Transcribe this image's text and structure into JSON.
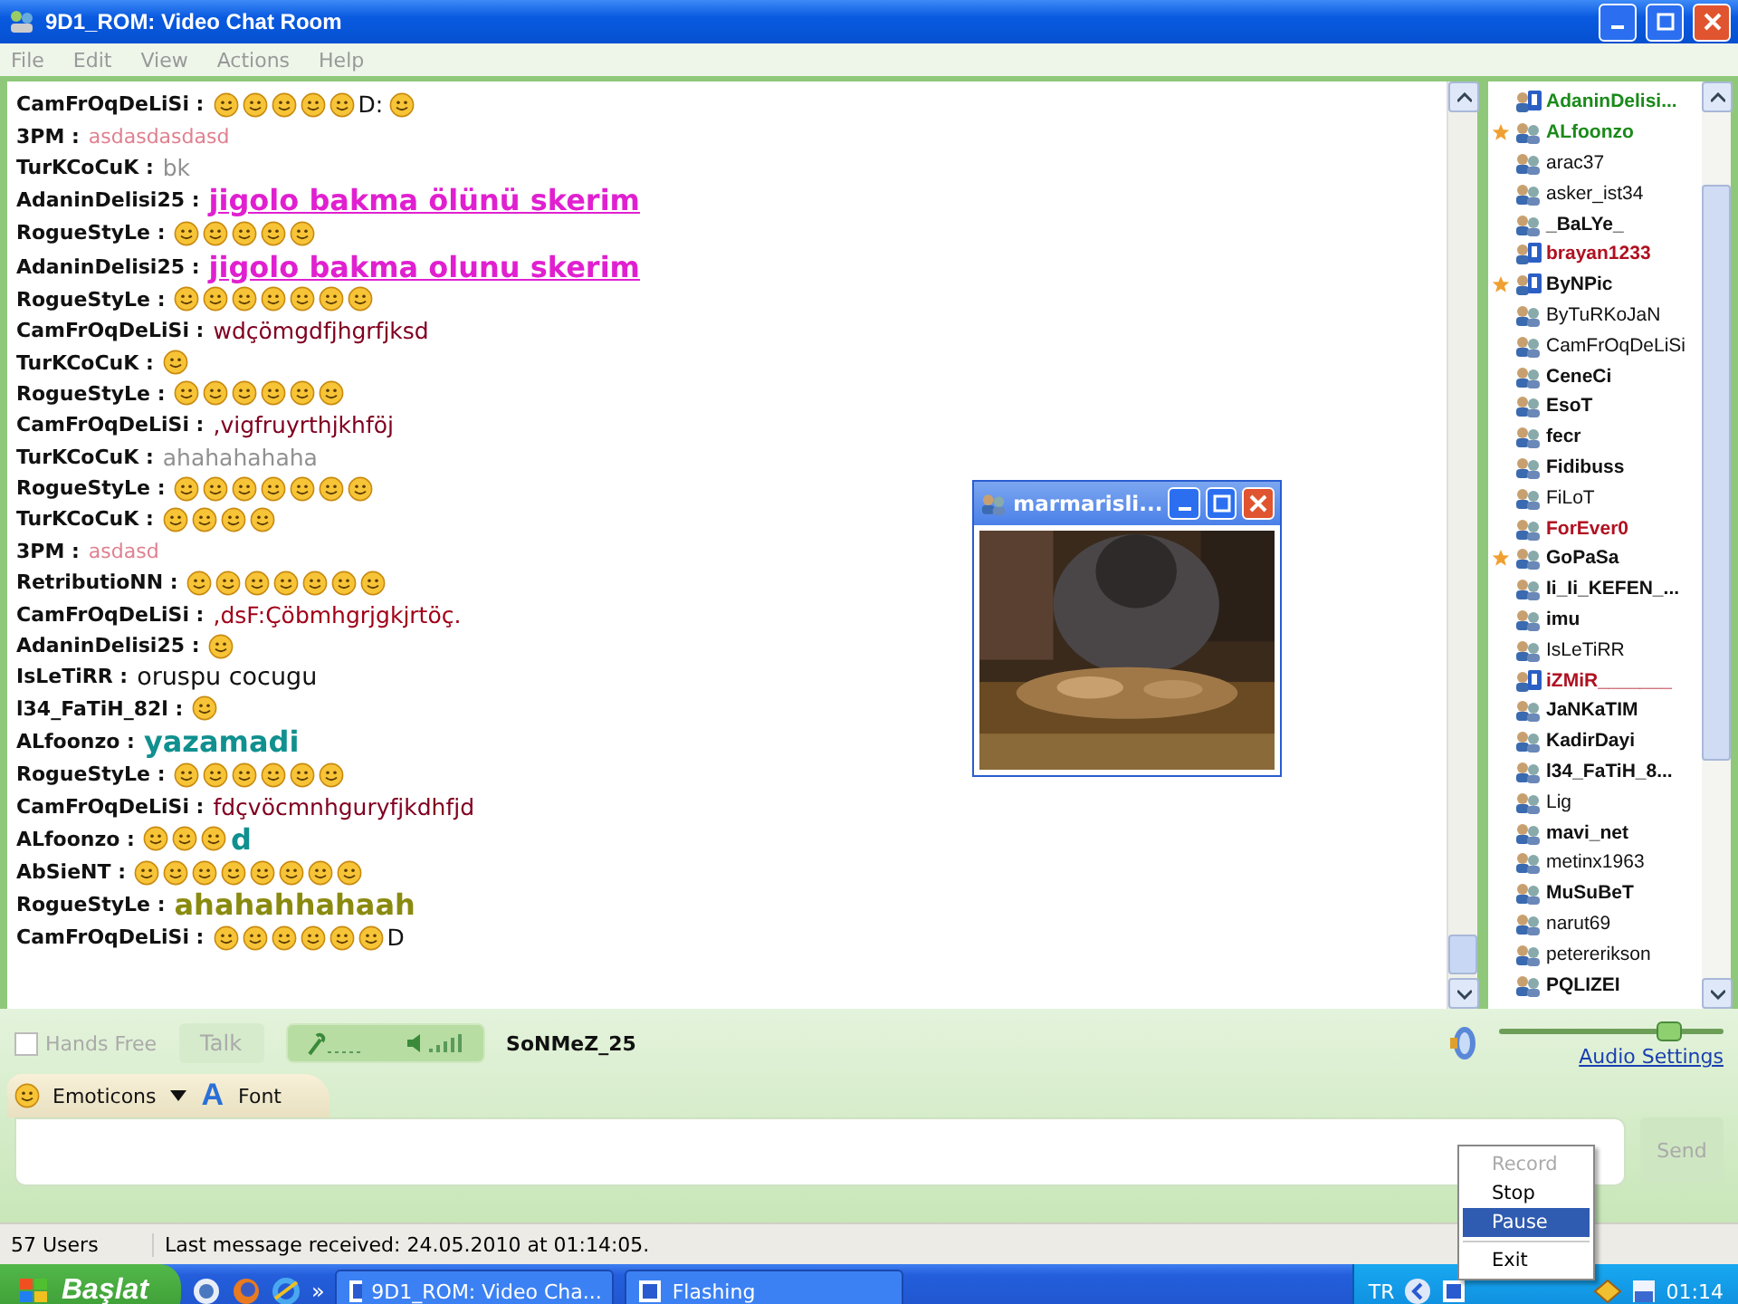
{
  "window": {
    "title": "9D1_ROM: Video Chat Room"
  },
  "menu": [
    "File",
    "Edit",
    "View",
    "Actions",
    "Help"
  ],
  "messages": [
    {
      "sender": "CamFrOqDeLiSi :",
      "segments": [
        {
          "kind": "smiley"
        },
        {
          "kind": "smiley"
        },
        {
          "kind": "smiley"
        },
        {
          "kind": "smiley"
        },
        {
          "kind": "smiley"
        },
        {
          "kind": "plain",
          "text": "D:",
          "color": "#111111"
        },
        {
          "kind": "smiley"
        }
      ]
    },
    {
      "sender": "3PM :",
      "segments": [
        {
          "kind": "small",
          "text": "asdasdasdasd",
          "color": "#e0808f"
        }
      ]
    },
    {
      "sender": "TurKCoCuK :",
      "segments": [
        {
          "kind": "plain",
          "text": "bk",
          "color": "#909090"
        }
      ]
    },
    {
      "sender": "AdaninDelisi25 :",
      "segments": [
        {
          "kind": "underlined",
          "text": "jigolo bakma ölünü skerim",
          "color": "#e020d0"
        }
      ]
    },
    {
      "sender": "RogueStyLe :",
      "segments": [
        {
          "kind": "smiley"
        },
        {
          "kind": "smiley"
        },
        {
          "kind": "smiley"
        },
        {
          "kind": "smiley"
        },
        {
          "kind": "smiley"
        }
      ]
    },
    {
      "sender": "AdaninDelisi25 :",
      "segments": [
        {
          "kind": "underlined",
          "text": "jigolo bakma olunu skerim",
          "color": "#e020d0"
        }
      ]
    },
    {
      "sender": "RogueStyLe :",
      "segments": [
        {
          "kind": "smiley"
        },
        {
          "kind": "smiley"
        },
        {
          "kind": "smiley"
        },
        {
          "kind": "smiley"
        },
        {
          "kind": "smiley"
        },
        {
          "kind": "smiley"
        },
        {
          "kind": "smiley"
        }
      ]
    },
    {
      "sender": "CamFrOqDeLiSi :",
      "segments": [
        {
          "kind": "plain",
          "text": "wdçömgdfjhgrfjksd",
          "color": "#800020"
        }
      ]
    },
    {
      "sender": "TurKCoCuK :",
      "segments": [
        {
          "kind": "smiley"
        }
      ]
    },
    {
      "sender": "RogueStyLe :",
      "segments": [
        {
          "kind": "smiley"
        },
        {
          "kind": "smiley"
        },
        {
          "kind": "smiley"
        },
        {
          "kind": "smiley"
        },
        {
          "kind": "smiley"
        },
        {
          "kind": "smiley"
        }
      ]
    },
    {
      "sender": "CamFrOqDeLiSi :",
      "segments": [
        {
          "kind": "plain",
          "text": ",vigfruyrthjkhföj",
          "color": "#800020"
        }
      ]
    },
    {
      "sender": "TurKCoCuK :",
      "segments": [
        {
          "kind": "plain",
          "text": "ahahahahaha",
          "color": "#909090"
        }
      ]
    },
    {
      "sender": "RogueStyLe :",
      "segments": [
        {
          "kind": "smiley"
        },
        {
          "kind": "smiley"
        },
        {
          "kind": "smiley"
        },
        {
          "kind": "smiley"
        },
        {
          "kind": "smiley"
        },
        {
          "kind": "smiley"
        },
        {
          "kind": "smiley"
        }
      ]
    },
    {
      "sender": "TurKCoCuK :",
      "segments": [
        {
          "kind": "smiley"
        },
        {
          "kind": "smiley"
        },
        {
          "kind": "smiley"
        },
        {
          "kind": "smiley"
        }
      ]
    },
    {
      "sender": "3PM :",
      "segments": [
        {
          "kind": "small",
          "text": "asdasd",
          "color": "#e0808f"
        }
      ]
    },
    {
      "sender": "RetributioNN :",
      "segments": [
        {
          "kind": "smiley"
        },
        {
          "kind": "smiley"
        },
        {
          "kind": "smiley"
        },
        {
          "kind": "smiley"
        },
        {
          "kind": "smiley"
        },
        {
          "kind": "smiley"
        },
        {
          "kind": "smiley"
        }
      ]
    },
    {
      "sender": "CamFrOqDeLiSi :",
      "segments": [
        {
          "kind": "plain",
          "text": ",dsF:Çöbmhgrjgkjrtöç.",
          "color": "#a00018"
        }
      ]
    },
    {
      "sender": "AdaninDelisi25 :",
      "segments": [
        {
          "kind": "smiley"
        }
      ]
    },
    {
      "sender": "IsLeTiRR :",
      "segments": [
        {
          "kind": "medium",
          "text": "oruspu cocugu",
          "color": "#111111"
        }
      ]
    },
    {
      "sender": "l34_FaTiH_82l :",
      "segments": [
        {
          "kind": "smiley"
        }
      ]
    },
    {
      "sender": "ALfoonzo :",
      "segments": [
        {
          "kind": "large",
          "text": "yazamadi",
          "color": "#10908f"
        }
      ]
    },
    {
      "sender": "RogueStyLe :",
      "segments": [
        {
          "kind": "smiley"
        },
        {
          "kind": "smiley"
        },
        {
          "kind": "smiley"
        },
        {
          "kind": "smiley"
        },
        {
          "kind": "smiley"
        },
        {
          "kind": "smiley"
        }
      ]
    },
    {
      "sender": "CamFrOqDeLiSi :",
      "segments": [
        {
          "kind": "plain",
          "text": "fdçvöcmnhguryfjkdhfjd",
          "color": "#800020"
        }
      ]
    },
    {
      "sender": "ALfoonzo :",
      "segments": [
        {
          "kind": "smiley"
        },
        {
          "kind": "smiley"
        },
        {
          "kind": "smiley"
        },
        {
          "kind": "large",
          "text": "d",
          "color": "#10908f"
        }
      ]
    },
    {
      "sender": "AbSieNT :",
      "segments": [
        {
          "kind": "smiley"
        },
        {
          "kind": "smiley"
        },
        {
          "kind": "smiley"
        },
        {
          "kind": "smiley"
        },
        {
          "kind": "smiley"
        },
        {
          "kind": "smiley"
        },
        {
          "kind": "smiley"
        },
        {
          "kind": "smiley"
        }
      ]
    },
    {
      "sender": "RogueStyLe :",
      "segments": [
        {
          "kind": "large",
          "text": "ahahahhahaah",
          "color": "#8a8a10"
        }
      ]
    },
    {
      "sender": "CamFrOqDeLiSi :",
      "segments": [
        {
          "kind": "smiley"
        },
        {
          "kind": "smiley"
        },
        {
          "kind": "smiley"
        },
        {
          "kind": "smiley"
        },
        {
          "kind": "smiley"
        },
        {
          "kind": "smiley"
        },
        {
          "kind": "plain",
          "text": "D",
          "color": "#111111"
        }
      ]
    }
  ],
  "video_window": {
    "title": "marmarisli..."
  },
  "users": [
    {
      "name": "AdaninDelisi...",
      "bold": true,
      "color": "#1a8a1a",
      "starred": false,
      "kind": "pro"
    },
    {
      "name": "ALfoonzo",
      "bold": true,
      "color": "#1a8a1a",
      "starred": true,
      "kind": "plain"
    },
    {
      "name": "arac37",
      "bold": false,
      "color": "#111111",
      "starred": false,
      "kind": "plain"
    },
    {
      "name": "asker_ist34",
      "bold": false,
      "color": "#111111",
      "starred": false,
      "kind": "plain"
    },
    {
      "name": "_BaLYe_",
      "bold": true,
      "color": "#111111",
      "starred": false,
      "kind": "plain"
    },
    {
      "name": "brayan1233",
      "bold": true,
      "color": "#b01020",
      "starred": false,
      "kind": "pro"
    },
    {
      "name": "ByNPic",
      "bold": true,
      "color": "#111111",
      "starred": true,
      "kind": "pro"
    },
    {
      "name": "ByTuRKoJaN",
      "bold": false,
      "color": "#111111",
      "starred": false,
      "kind": "plain"
    },
    {
      "name": "CamFrOqDeLiSi",
      "bold": false,
      "color": "#111111",
      "starred": false,
      "kind": "plain"
    },
    {
      "name": "CeneCi",
      "bold": true,
      "color": "#111111",
      "starred": false,
      "kind": "plain"
    },
    {
      "name": "EsoT",
      "bold": true,
      "color": "#111111",
      "starred": false,
      "kind": "plain"
    },
    {
      "name": "fecr",
      "bold": true,
      "color": "#111111",
      "starred": false,
      "kind": "plain"
    },
    {
      "name": "Fidibuss",
      "bold": true,
      "color": "#111111",
      "starred": false,
      "kind": "plain"
    },
    {
      "name": "FiLoT",
      "bold": false,
      "color": "#111111",
      "starred": false,
      "kind": "plain"
    },
    {
      "name": "ForEver0",
      "bold": true,
      "color": "#b01020",
      "starred": false,
      "kind": "plain"
    },
    {
      "name": "GoPaSa",
      "bold": true,
      "color": "#111111",
      "starred": true,
      "kind": "plain"
    },
    {
      "name": "Ii_Ii_KEFEN_...",
      "bold": true,
      "color": "#111111",
      "starred": false,
      "kind": "plain"
    },
    {
      "name": "imu",
      "bold": true,
      "color": "#111111",
      "starred": false,
      "kind": "plain"
    },
    {
      "name": "IsLeTiRR",
      "bold": false,
      "color": "#111111",
      "starred": false,
      "kind": "plain"
    },
    {
      "name": "iZMiR_______",
      "bold": true,
      "color": "#b01020",
      "starred": false,
      "kind": "pro"
    },
    {
      "name": "JaNKaTIM",
      "bold": true,
      "color": "#111111",
      "starred": false,
      "kind": "plain"
    },
    {
      "name": "KadirDayi",
      "bold": true,
      "color": "#111111",
      "starred": false,
      "kind": "plain"
    },
    {
      "name": "l34_FaTiH_8...",
      "bold": true,
      "color": "#111111",
      "starred": false,
      "kind": "plain"
    },
    {
      "name": "Lig",
      "bold": false,
      "color": "#111111",
      "starred": false,
      "kind": "plain"
    },
    {
      "name": "mavi_net",
      "bold": true,
      "color": "#111111",
      "starred": false,
      "kind": "plain"
    },
    {
      "name": "metinx1963",
      "bold": false,
      "color": "#111111",
      "starred": false,
      "kind": "plain"
    },
    {
      "name": "MuSuBeT",
      "bold": true,
      "color": "#111111",
      "starred": false,
      "kind": "plain"
    },
    {
      "name": "narut69",
      "bold": false,
      "color": "#111111",
      "starred": false,
      "kind": "plain"
    },
    {
      "name": "petererikson",
      "bold": false,
      "color": "#111111",
      "starred": false,
      "kind": "plain"
    },
    {
      "name": "PQLIZEI",
      "bold": true,
      "color": "#111111",
      "starred": false,
      "kind": "plain"
    }
  ],
  "voice": {
    "hands_free": {
      "label": "Hands Free",
      "checked": false
    },
    "talk_button": {
      "label": "Talk",
      "disabled": true
    },
    "speaker": "SoNMeZ_25",
    "volume": {
      "level": 0.75
    },
    "audio_settings": "Audio Settings"
  },
  "toolbar": {
    "emoticons": "Emoticons",
    "font_icon": "A",
    "font": "Font"
  },
  "send_button": {
    "label": "Send",
    "disabled": true
  },
  "context_menu": [
    {
      "label": "Record",
      "disabled": true,
      "selected": false
    },
    {
      "label": "Stop",
      "disabled": false,
      "selected": false
    },
    {
      "label": "Pause",
      "disabled": false,
      "selected": true
    },
    {
      "label": "Exit",
      "disabled": false,
      "selected": false
    }
  ],
  "status_bar": {
    "users": "57 Users",
    "last_message": "Last message received: 24.05.2010 at 01:14:05."
  },
  "taskbar": {
    "start": "Başlat",
    "more": "»",
    "tasks": [
      "9D1_ROM: Video Cha...",
      "Flashing"
    ],
    "language": "TR",
    "clock": "01:14"
  }
}
